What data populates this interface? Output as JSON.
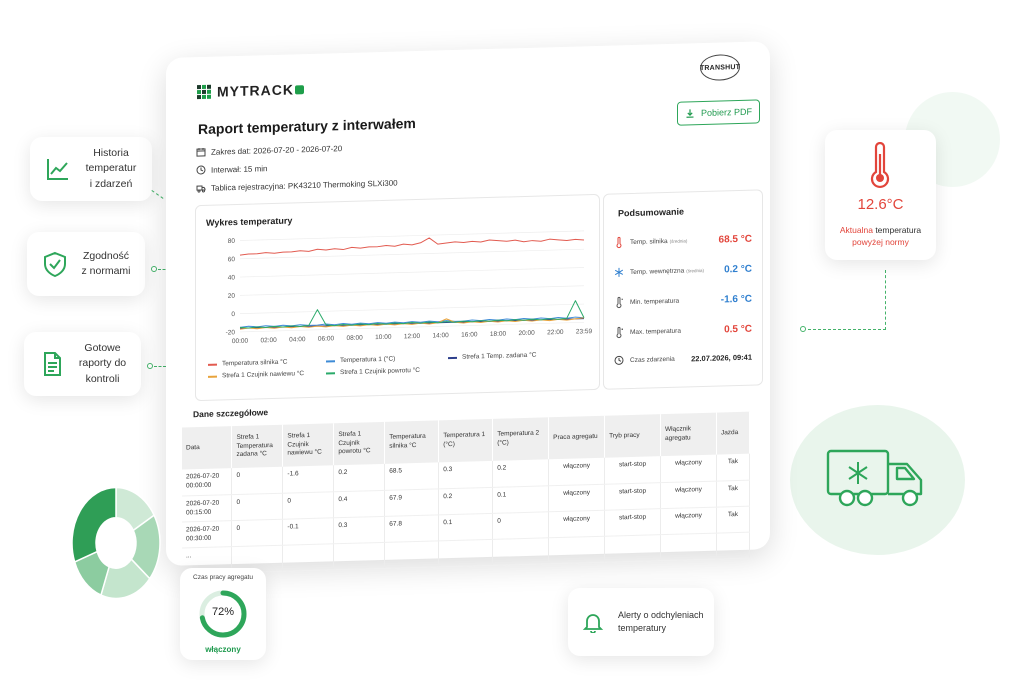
{
  "colors": {
    "brand_green": "#1e9e4a",
    "engine_temp": "#e25b50",
    "temp_internal": "#3e8bd6",
    "zone_setpoint": "#2d3f8c",
    "zone_supply": "#e8a33c",
    "zone_return": "#2aaa6a",
    "alert_red": "#e2453b",
    "value_blue": "#2f7fcf"
  },
  "features": [
    {
      "label": "Historia temperatur i zdarzeń",
      "icon": "chart-line-icon"
    },
    {
      "label": "Zgodność z normami",
      "icon": "shield-check-icon"
    },
    {
      "label": "Gotowe raporty do kontroli",
      "icon": "document-icon"
    }
  ],
  "app": {
    "logo_text": "MYTRACK",
    "partner_logo": "TRANSHUT"
  },
  "report": {
    "title": "Raport temperatury z interwałem",
    "date_range": "Zakres dat: 2026-07-20 - 2026-07-20",
    "interval": "Interwał: 15 min",
    "plate": "Tablica rejestracyjna: PK43210 Thermoking SLXi300",
    "pdf_button": "Pobierz PDF"
  },
  "chart": {
    "title": "Wykres temperatury"
  },
  "chart_data": {
    "type": "line",
    "x_ticks": [
      "00:00",
      "02:00",
      "04:00",
      "06:00",
      "08:00",
      "10:00",
      "12:00",
      "14:00",
      "16:00",
      "18:00",
      "20:00",
      "22:00",
      "23:59"
    ],
    "y_ticks": [
      80,
      60,
      40,
      20,
      0,
      -20
    ],
    "ylim": [
      -20,
      85
    ],
    "grid": true,
    "legend_position": "bottom",
    "series": [
      {
        "name": "Temperatura silnika °C",
        "color": "#e25b50",
        "values": [
          64,
          65,
          65,
          66,
          65,
          66,
          66,
          67,
          66,
          68,
          67,
          68,
          67,
          69,
          68,
          69,
          69,
          70,
          69,
          71,
          70,
          72,
          77,
          70,
          71,
          72,
          71,
          72,
          71,
          73,
          72,
          71,
          72,
          70,
          71,
          70,
          72,
          71,
          70,
          71,
          70
        ]
      },
      {
        "name": "Temperatura 1 (°C)",
        "color": "#3e8bd6",
        "values": [
          -15,
          -14,
          -15,
          -14,
          -15,
          -14,
          -15,
          -14,
          -15,
          -15,
          -14,
          -15,
          -14,
          -15,
          -14,
          -15,
          -14,
          -15,
          -14,
          -15,
          -14,
          -15,
          -14,
          -15,
          -14,
          -15,
          -15,
          -14,
          -15,
          -14,
          -15,
          -14,
          -15,
          -14,
          -15,
          -14,
          -15,
          -14,
          -15,
          -14,
          -15
        ]
      },
      {
        "name": "Strefa 1 Temp. zadana °C",
        "color": "#2d3f8c",
        "values": [
          -16,
          -16,
          -16,
          -16,
          -16,
          -16,
          -16,
          -16,
          -16,
          -16,
          -16,
          -16,
          -16,
          -16,
          -16,
          -16,
          -16,
          -16,
          -16,
          -16,
          -16,
          -16,
          -16,
          -16,
          -16,
          -16,
          -16,
          -16,
          -16,
          -16,
          -16,
          -16,
          -16,
          -16,
          -16,
          -16,
          -16,
          -16,
          -16,
          -16,
          -16
        ]
      },
      {
        "name": "Strefa 1 Czujnik nawiewu °C",
        "color": "#e8a33c",
        "values": [
          -17,
          -16,
          -17,
          -16,
          -17,
          -16,
          -17,
          -16,
          -17,
          -16,
          -17,
          -16,
          -17,
          -16,
          -17,
          -16,
          -17,
          -16,
          -17,
          -16,
          -17,
          -16,
          -17,
          -16,
          -12,
          -16,
          -17,
          -16,
          -17,
          -16,
          -17,
          -16,
          -17,
          -16,
          -17,
          -16,
          -17,
          -16,
          -17,
          -16,
          -15
        ]
      },
      {
        "name": "Strefa 1 Czujnik powrotu °C",
        "color": "#2aaa6a",
        "values": [
          -15,
          -16,
          -15,
          -16,
          -15,
          -16,
          -15,
          -16,
          -15,
          2,
          -15,
          -16,
          -15,
          -16,
          -15,
          -16,
          -15,
          -16,
          -15,
          -16,
          -15,
          -16,
          -15,
          -16,
          -15,
          -16,
          -15,
          -16,
          -15,
          -16,
          -15,
          -16,
          -15,
          -16,
          -15,
          -16,
          -15,
          -16,
          -15,
          4,
          -15
        ]
      }
    ]
  },
  "summary": {
    "title": "Podsumowanie",
    "rows": [
      {
        "label": "Temp. silnika",
        "note": "(średnia)",
        "value": "68.5 °C",
        "icon": "thermometer-icon"
      },
      {
        "label": "Temp. wewnętrzna",
        "note": "(średnia)",
        "value": "0.2 °C",
        "icon": "snowflake-icon"
      },
      {
        "label": "Min. temperatura",
        "note": "",
        "value": "-1.6 °C",
        "icon": "thermometer-low-icon"
      },
      {
        "label": "Max. temperatura",
        "note": "",
        "value": "0.5 °C",
        "icon": "thermometer-high-icon"
      },
      {
        "label": "Czas zdarzenia",
        "note": "",
        "value": "22.07.2026, 09:41",
        "icon": "clock-icon"
      }
    ]
  },
  "details": {
    "title": "Dane szczegółowe",
    "columns": [
      "Data",
      "Strefa 1 Temperatura zadana °C",
      "Strefa 1 Czujnik nawiewu °C",
      "Strefa 1 Czujnik powrotu °C",
      "Temperatura silnika °C",
      "Temperatura 1 (°C)",
      "Temperatura 2 (°C)",
      "Praca agregatu",
      "Tryb pracy",
      "Włącznik agregatu",
      "Jazda"
    ],
    "rows": [
      [
        "2026-07-20 00:00:00",
        "0",
        "-1.6",
        "0.2",
        "68.5",
        "0.3",
        "0.2",
        "włączony",
        "start-stop",
        "włączony",
        "Tak"
      ],
      [
        "2026-07-20 00:15:00",
        "0",
        "0",
        "0.4",
        "67.9",
        "0.2",
        "0.1",
        "włączony",
        "start-stop",
        "włączony",
        "Tak"
      ],
      [
        "2026-07-20 00:30:00",
        "0",
        "-0.1",
        "0.3",
        "67.8",
        "0.1",
        "0",
        "włączony",
        "start-stop",
        "włączony",
        "Tak"
      ],
      [
        "...",
        "",
        "",
        "",
        "",
        "",
        "",
        "",
        "",
        "",
        ""
      ]
    ]
  },
  "gauge": {
    "title": "Czas pracy agregatu",
    "value": "72%",
    "percent": 72,
    "status": "włączony"
  },
  "alert": {
    "label": "Alerty o odchyleniach temperatury"
  },
  "current_temp": {
    "value": "12.6°C",
    "label_a": "Aktualna",
    "label_b": "temperatura",
    "label_c": "powyżej normy"
  }
}
